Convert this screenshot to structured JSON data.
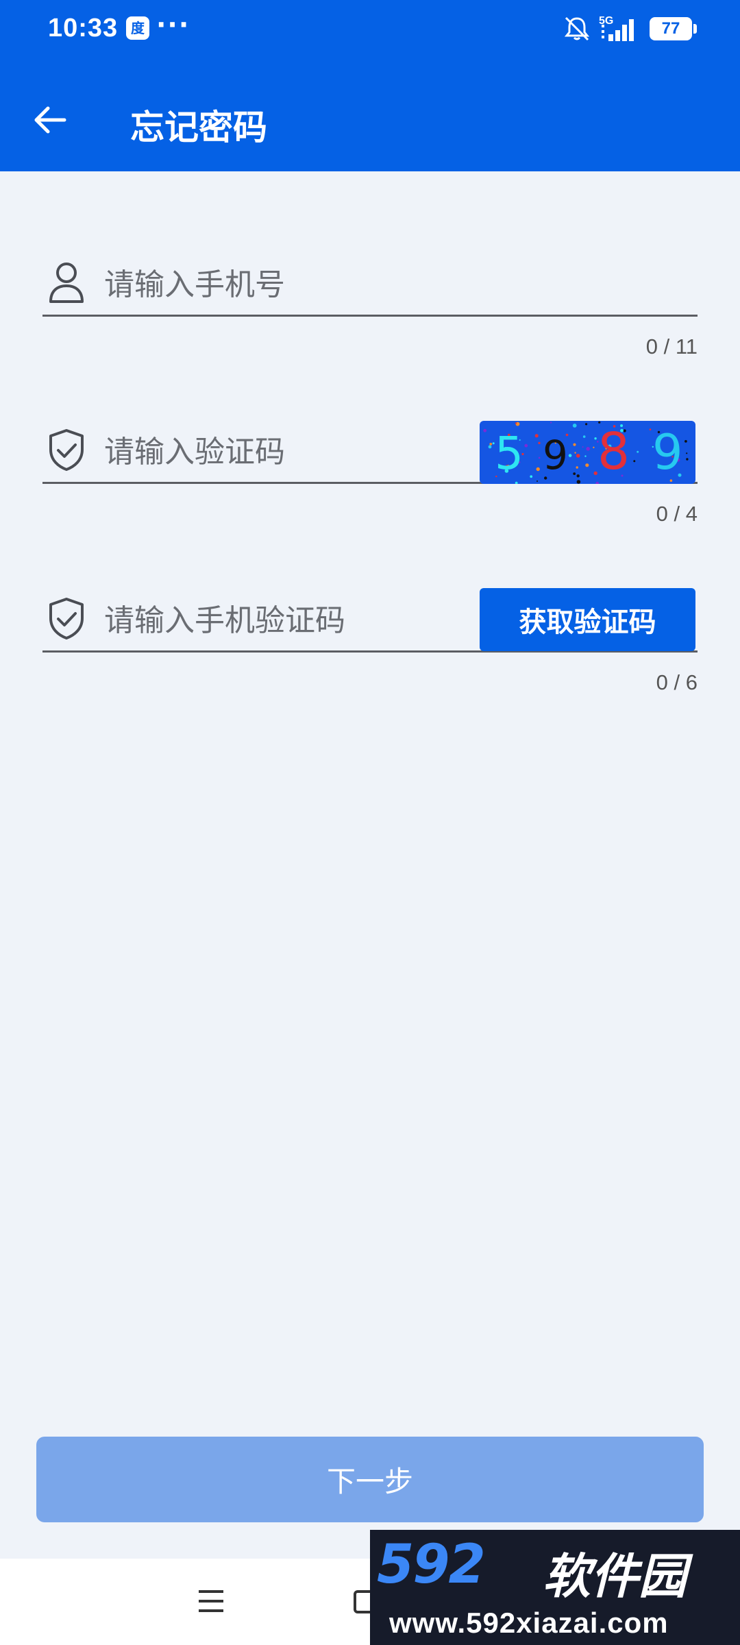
{
  "status_bar": {
    "time": "10:33",
    "app_badge": "度",
    "more": "···",
    "network": "5G",
    "battery": "77"
  },
  "header": {
    "title": "忘记密码",
    "back_icon": "arrow-left-icon"
  },
  "form": {
    "phone": {
      "placeholder": "请输入手机号",
      "value": "",
      "counter": "0 / 11",
      "icon": "person-icon"
    },
    "captcha": {
      "placeholder": "请输入验证码",
      "value": "",
      "counter": "0 / 4",
      "icon": "shield-check-icon",
      "image_chars": [
        "5",
        "9",
        "8",
        "9"
      ],
      "image_colors": [
        "#2ee6f2",
        "#111111",
        "#e2303a",
        "#27c9f0"
      ]
    },
    "sms_code": {
      "placeholder": "请输入手机验证码",
      "value": "",
      "counter": "0 / 6",
      "icon": "shield-check-icon",
      "button_label": "获取验证码"
    }
  },
  "next_button": {
    "label": "下一步",
    "enabled": false
  },
  "colors": {
    "primary": "#0561e5",
    "page_bg": "#eff3f9",
    "disabled_button": "#7aa6ea"
  },
  "watermark": {
    "logo": "592",
    "logo_cn": "软件园",
    "url": "www.592xiazai.com"
  }
}
